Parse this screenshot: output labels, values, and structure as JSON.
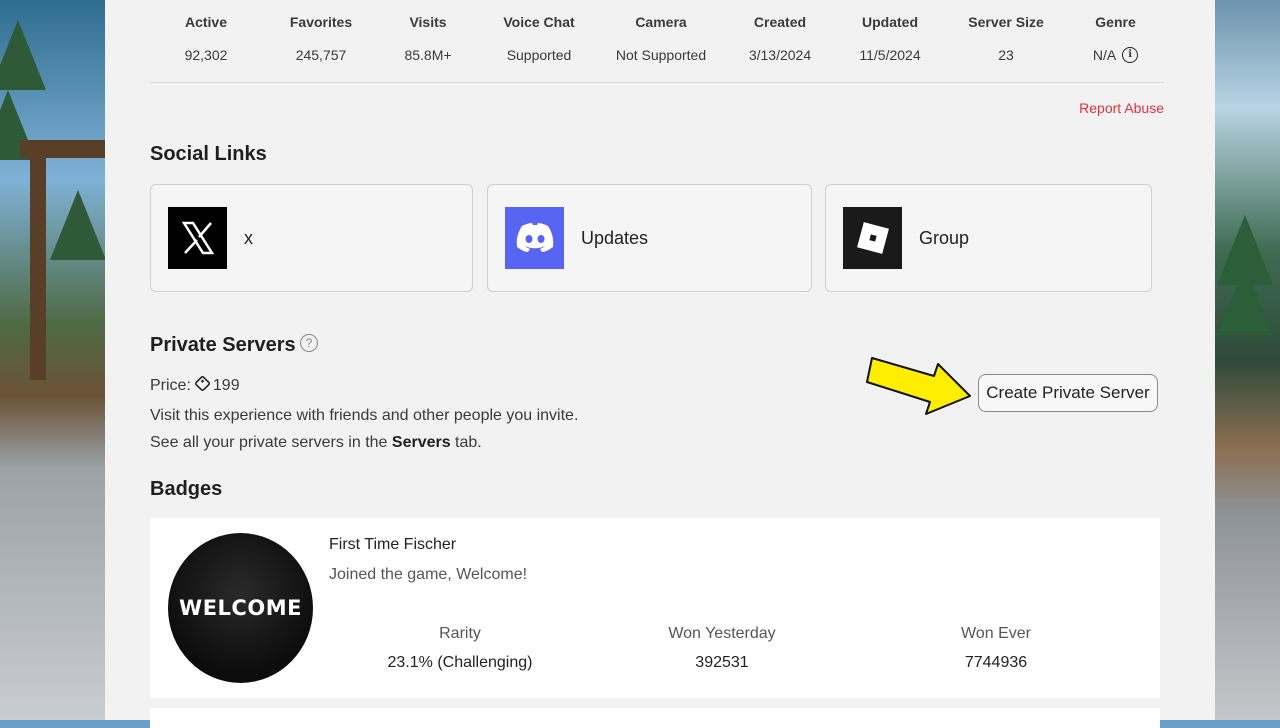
{
  "stats": [
    {
      "label": "Active",
      "value": "92,302"
    },
    {
      "label": "Favorites",
      "value": "245,757"
    },
    {
      "label": "Visits",
      "value": "85.8M+"
    },
    {
      "label": "Voice Chat",
      "value": "Supported"
    },
    {
      "label": "Camera",
      "value": "Not Supported"
    },
    {
      "label": "Created",
      "value": "3/13/2024"
    },
    {
      "label": "Updated",
      "value": "11/5/2024"
    },
    {
      "label": "Server Size",
      "value": "23"
    },
    {
      "label": "Genre",
      "value": "N/A"
    }
  ],
  "report_abuse": "Report Abuse",
  "social": {
    "title": "Social Links",
    "links": [
      {
        "label": "x",
        "icon": "x-logo-icon",
        "color": "#000000"
      },
      {
        "label": "Updates",
        "icon": "discord-logo-icon",
        "color": "#5865f2"
      },
      {
        "label": "Group",
        "icon": "roblox-logo-icon",
        "color": "#1a1a1a"
      }
    ]
  },
  "private_servers": {
    "title": "Private Servers",
    "price_label": "Price:",
    "price_value": "199",
    "line1": "Visit this experience with friends and other people you invite.",
    "line2_prefix": "See all your private servers in the ",
    "line2_bold": "Servers",
    "line2_suffix": " tab.",
    "create_button": "Create Private Server",
    "arrow_color": "#ffee00"
  },
  "badges": {
    "title": "Badges",
    "items": [
      {
        "image_text": "WELCOME",
        "name": "First Time Fischer",
        "description": "Joined the game, Welcome!",
        "rarity_label": "Rarity",
        "rarity_value": "23.1% (Challenging)",
        "won_yesterday_label": "Won Yesterday",
        "won_yesterday_value": "392531",
        "won_ever_label": "Won Ever",
        "won_ever_value": "7744936"
      }
    ]
  }
}
